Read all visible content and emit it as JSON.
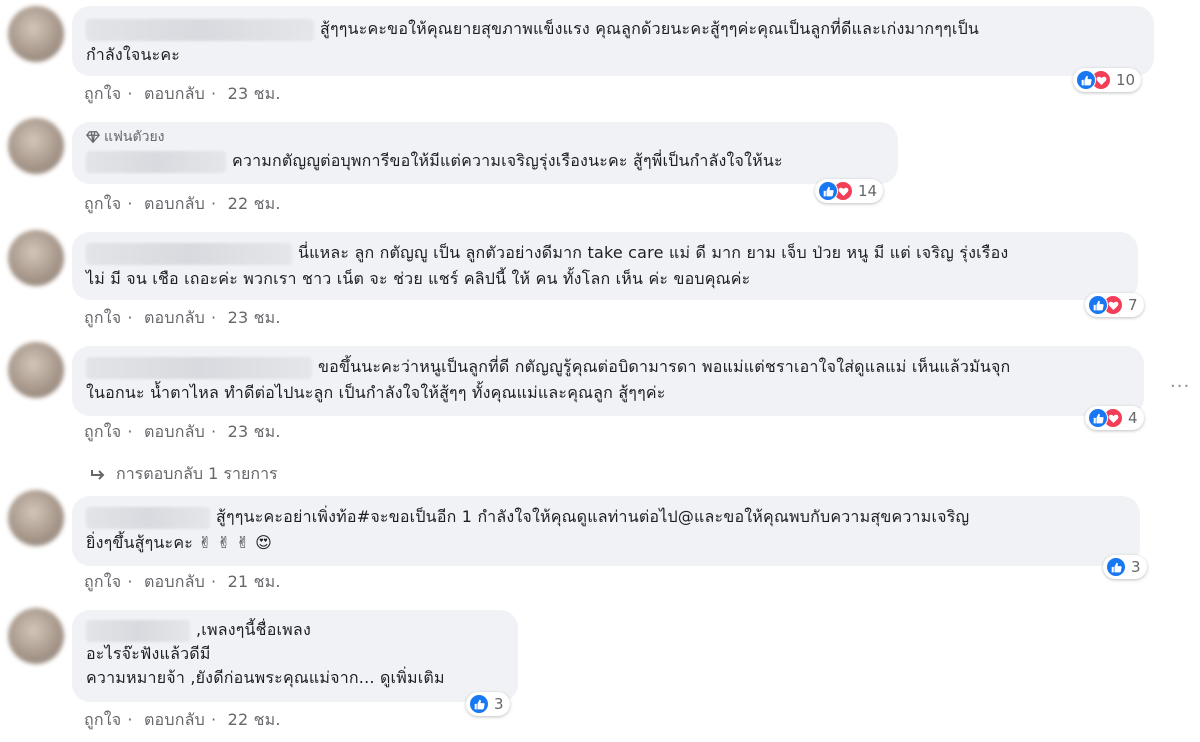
{
  "comments": [
    {
      "text_line1": "สู้ๆๆนะคะขอให้คุณยายสุขภาพแข็งแรง คุณลูกด้วยนะคะสู้ๆๆค่ะคุณเป็นลูกที่ดีและเก่งมากๆๆเป็น",
      "text_line2": "กำลังใจนะคะ",
      "like": "ถูกใจ",
      "reply": "ตอบกลับ",
      "time": "23 ชม.",
      "reactions": [
        "like",
        "love"
      ],
      "count": "10"
    },
    {
      "badge": "แฟนตัวยง",
      "text_line1": "ความกตัญญูต่อบุพการีขอให้มีแต่ความเจริญรุ่งเรืองนะคะ สู้ๆพี่เป็นกำลังใจให้นะ",
      "like": "ถูกใจ",
      "reply": "ตอบกลับ",
      "time": "22 ชม.",
      "reactions": [
        "like",
        "love"
      ],
      "count": "14"
    },
    {
      "text_line1": "นี่แหละ ลูก กตัญญู เป็น ลูกตัวอย่างดีมาก take care แม่ ดี มาก ยาม เจ็บ ป่วย หนู มี แต่ เจริญ รุ่งเรือง",
      "text_line2": "ไม่ มี จน เชือ เถอะค่ะ พวกเรา ชาว เน็ต จะ ช่วย แชร์ คลิปนี้ ให้ คน ทั้งโลก เห็น ค่ะ ขอบคุณค่ะ",
      "like": "ถูกใจ",
      "reply": "ตอบกลับ",
      "time": "23 ชม.",
      "reactions": [
        "like",
        "love"
      ],
      "count": "7"
    },
    {
      "text_line1": "ขอขึ้นนะคะว่าหนูเป็นลูกที่ดี กตัญญูรู้คุณต่อบิดามารดา พอแม่แต่ชราเอาใจใส่ดูแลแม่ เห็นแล้วมันจุก",
      "text_line2": "ในอกนะ น้ำตาไหล ทำดีต่อไปนะลูก เป็นกำลังใจให้สู้ๆๆ ทั้งคุณแม่และคุณลูก สู้ๆๆค่ะ",
      "like": "ถูกใจ",
      "reply": "ตอบกลับ",
      "time": "23 ชม.",
      "reactions": [
        "like",
        "love"
      ],
      "count": "4",
      "replies_link": "การตอบกลับ 1 รายการ",
      "more": "···"
    },
    {
      "text_line1": "สู้ๆๆนะคะอย่าเพิ่งท้อ#จะขอเป็นอีก 1 กำลังใจให้คุณดูแลท่านต่อไป@และขอให้คุณพบกับความสุขความเจริญ",
      "text_line2": "ยิ่งๆขึ้นสู้ๆนะคะ",
      "emojis": [
        "✌",
        "✌",
        "✌",
        "😍"
      ],
      "like": "ถูกใจ",
      "reply": "ตอบกลับ",
      "time": "21 ชม.",
      "reactions": [
        "like"
      ],
      "count": "3"
    },
    {
      "text_line1": ",เพลงๆนี้ชื่อเพลง",
      "text_line2": "อะไรจ๊ะฟังแล้วดีมี",
      "text_line3": "ความหมายจ้า ,ยังดีก่อนพระคุณแม่จาก...",
      "see_more": "ดูเพิ่มเติม",
      "like": "ถูกใจ",
      "reply": "ตอบกลับ",
      "time": "22 ชม.",
      "reactions": [
        "like"
      ],
      "count": "3"
    }
  ],
  "colors": {
    "like": "#1877f2",
    "love": "#f33e58",
    "bubble": "#f0f2f5",
    "meta": "#65676b"
  },
  "icons": {
    "like": "thumbs-up-icon",
    "love": "heart-icon",
    "badge": "diamond-icon",
    "reply_arrow": "reply-arrow-icon"
  }
}
